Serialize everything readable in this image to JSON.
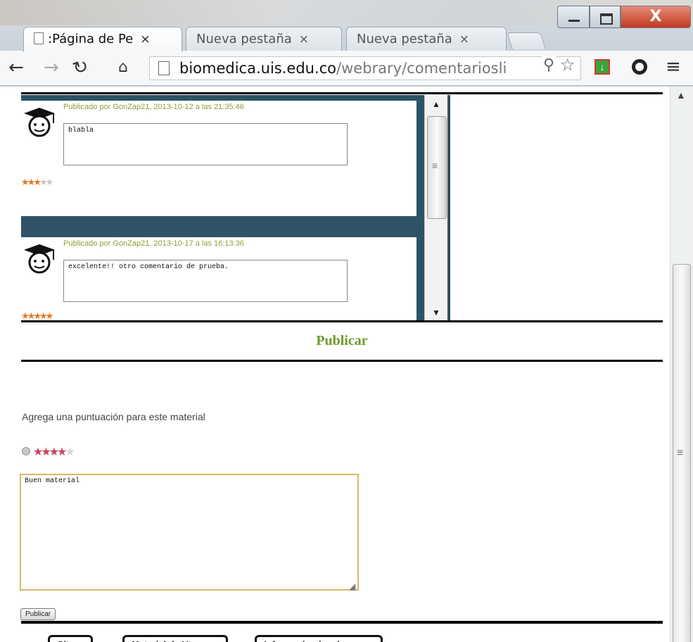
{
  "browser": {
    "tabs": [
      {
        "label": ":Página de Pe",
        "active": true
      },
      {
        "label": "Nueva pestaña",
        "active": false
      },
      {
        "label": "Nueva pestaña",
        "active": false
      }
    ],
    "tab_close": "×",
    "window_close": "X",
    "url_domain": "biomedica.uis.edu.co",
    "url_path": "/webrary/comentariosli"
  },
  "comments": [
    {
      "meta": "Publicado por GonZap21, 2013-10-12 a las 21:35:46",
      "text": "blabla",
      "rating": 3,
      "max": 5
    },
    {
      "meta": "Publicado por GonZap21, 2013-10-17 a las 16:13:36",
      "text": "excelente!! otro comentario de prueba.",
      "rating": 5,
      "max": 5
    }
  ],
  "publish": {
    "title": "Publicar",
    "rate_label": "Agrega una puntuación para este material",
    "current_rating": 4,
    "max_rating": 5,
    "textarea_value": "Buen material",
    "button_label": "Publicar"
  },
  "bottom_buttons": [
    "Cit",
    "Material de Ut",
    "Informacion local"
  ],
  "colors": {
    "frame_bg": "#2e5266",
    "accent_green": "#6e9a2b",
    "star_orange": "#e07a23",
    "star_red": "#c9455a"
  }
}
